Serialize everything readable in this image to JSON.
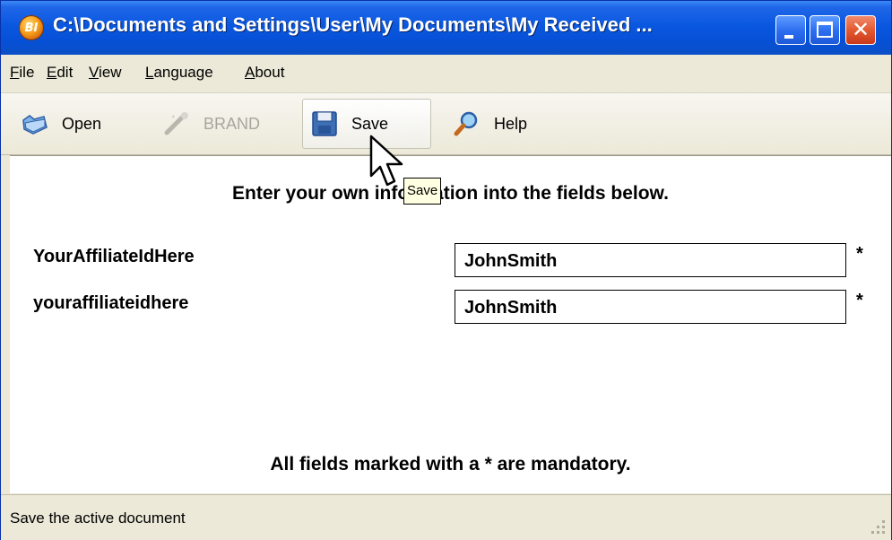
{
  "window": {
    "title": "C:\\Documents and Settings\\User\\My Documents\\My Received ...",
    "app_icon_glyph": "BI",
    "controls": {
      "minimize": "minimize-icon",
      "maximize": "maximize-icon",
      "close": "close-icon",
      "close_glyph": "✕"
    }
  },
  "menu": [
    {
      "label": "File",
      "mnemonic": "F",
      "rest": "ile"
    },
    {
      "label": "Edit",
      "mnemonic": "E",
      "rest": "dit"
    },
    {
      "label": "View",
      "mnemonic": "V",
      "rest": "iew"
    },
    {
      "label": "Language",
      "mnemonic": "L",
      "rest": "anguage"
    },
    {
      "label": "About",
      "mnemonic": "A",
      "rest": "bout"
    }
  ],
  "toolbar": {
    "open": {
      "label": "Open",
      "icon": "open-folder-icon"
    },
    "brand": {
      "label": "BRAND",
      "icon": "brand-wand-icon",
      "disabled": true
    },
    "save": {
      "label": "Save",
      "icon": "floppy-disk-icon",
      "hovered": true
    },
    "help": {
      "label": "Help",
      "icon": "help-magnifier-icon"
    }
  },
  "form": {
    "instruction": "Enter your own information into the fields below.",
    "fields": [
      {
        "label": "YourAffiliateIdHere",
        "value": "JohnSmith",
        "required_marker": "*"
      },
      {
        "label": "youraffiliateidhere",
        "value": "JohnSmith",
        "required_marker": "*"
      }
    ],
    "footer_note": "All fields marked with a * are mandatory."
  },
  "tooltip": {
    "text": "Save"
  },
  "statusbar": {
    "text": "Save the active document"
  },
  "colors": {
    "titlebar": "#0a58e0",
    "chrome": "#ece9d8",
    "close_button": "#e35a32",
    "tooltip_bg": "#ffffe1"
  }
}
